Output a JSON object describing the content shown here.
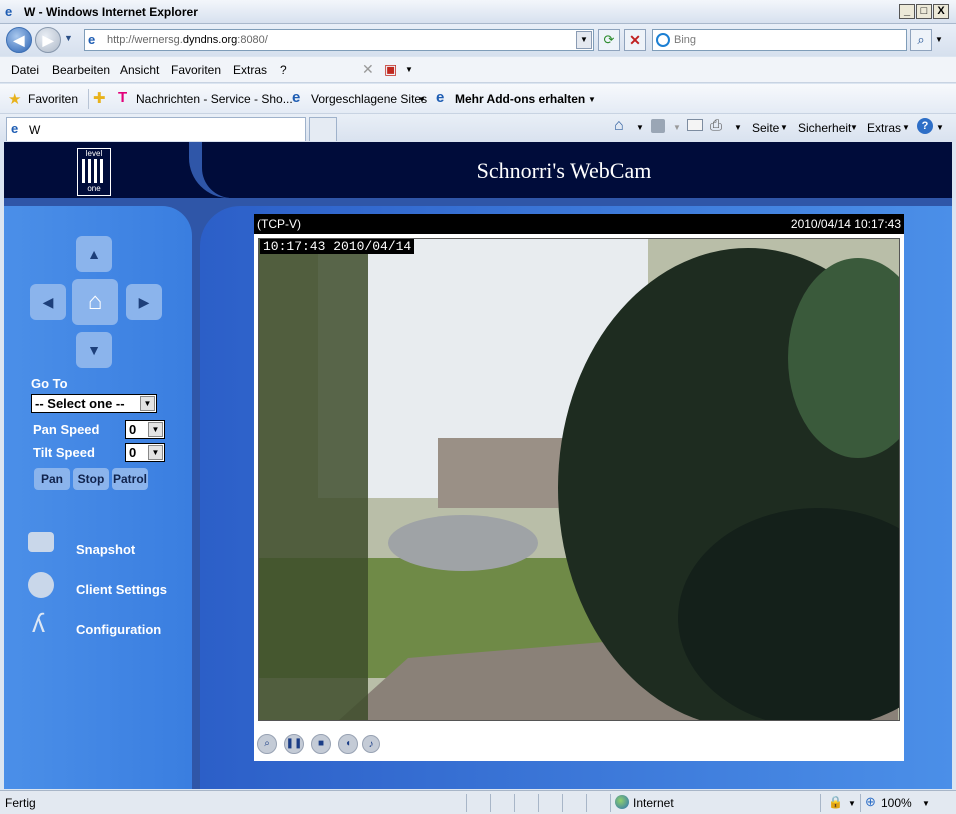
{
  "window": {
    "title": "W - Windows Internet Explorer",
    "min": "_",
    "max": "□",
    "close": "X"
  },
  "address": {
    "url_prefix": "http://wernersg.",
    "url_host": "dyndns.org",
    "url_suffix": ":8080/"
  },
  "search": {
    "placeholder": "Bing"
  },
  "menu": [
    "Datei",
    "Bearbeiten",
    "Ansicht",
    "Favoriten",
    "Extras",
    "?"
  ],
  "favorites": {
    "label": "Favoriten",
    "items": [
      "Nachrichten - Service - Sho...",
      "Vorgeschlagene Sites",
      "Mehr Add-ons erhalten"
    ]
  },
  "tab": {
    "title": "W"
  },
  "commandbar": {
    "seite": "Seite",
    "sicherheit": "Sicherheit",
    "extras": "Extras"
  },
  "page": {
    "header_title": "Schnorri's WebCam",
    "logo_top": "level",
    "logo_bottom": "one",
    "goto_label": "Go To",
    "goto_value": "-- Select one --",
    "pan_speed_label": "Pan Speed",
    "pan_speed_value": "0",
    "tilt_speed_label": "Tilt Speed",
    "tilt_speed_value": "0",
    "buttons": [
      "Pan",
      "Stop",
      "Patrol"
    ],
    "side_items": [
      "Snapshot",
      "Client Settings",
      "Configuration"
    ],
    "video_mode": "(TCP-V)",
    "video_datetime": "2010/04/14 10:17:43",
    "overlay_timestamp": "10:17:43 2010/04/14"
  },
  "status": {
    "left": "Fertig",
    "zone": "Internet",
    "zoom": "100%"
  },
  "colors": {
    "header": "#000c3a",
    "sidebar": "#4b8fe8",
    "page_bg": "#2f56a8"
  }
}
